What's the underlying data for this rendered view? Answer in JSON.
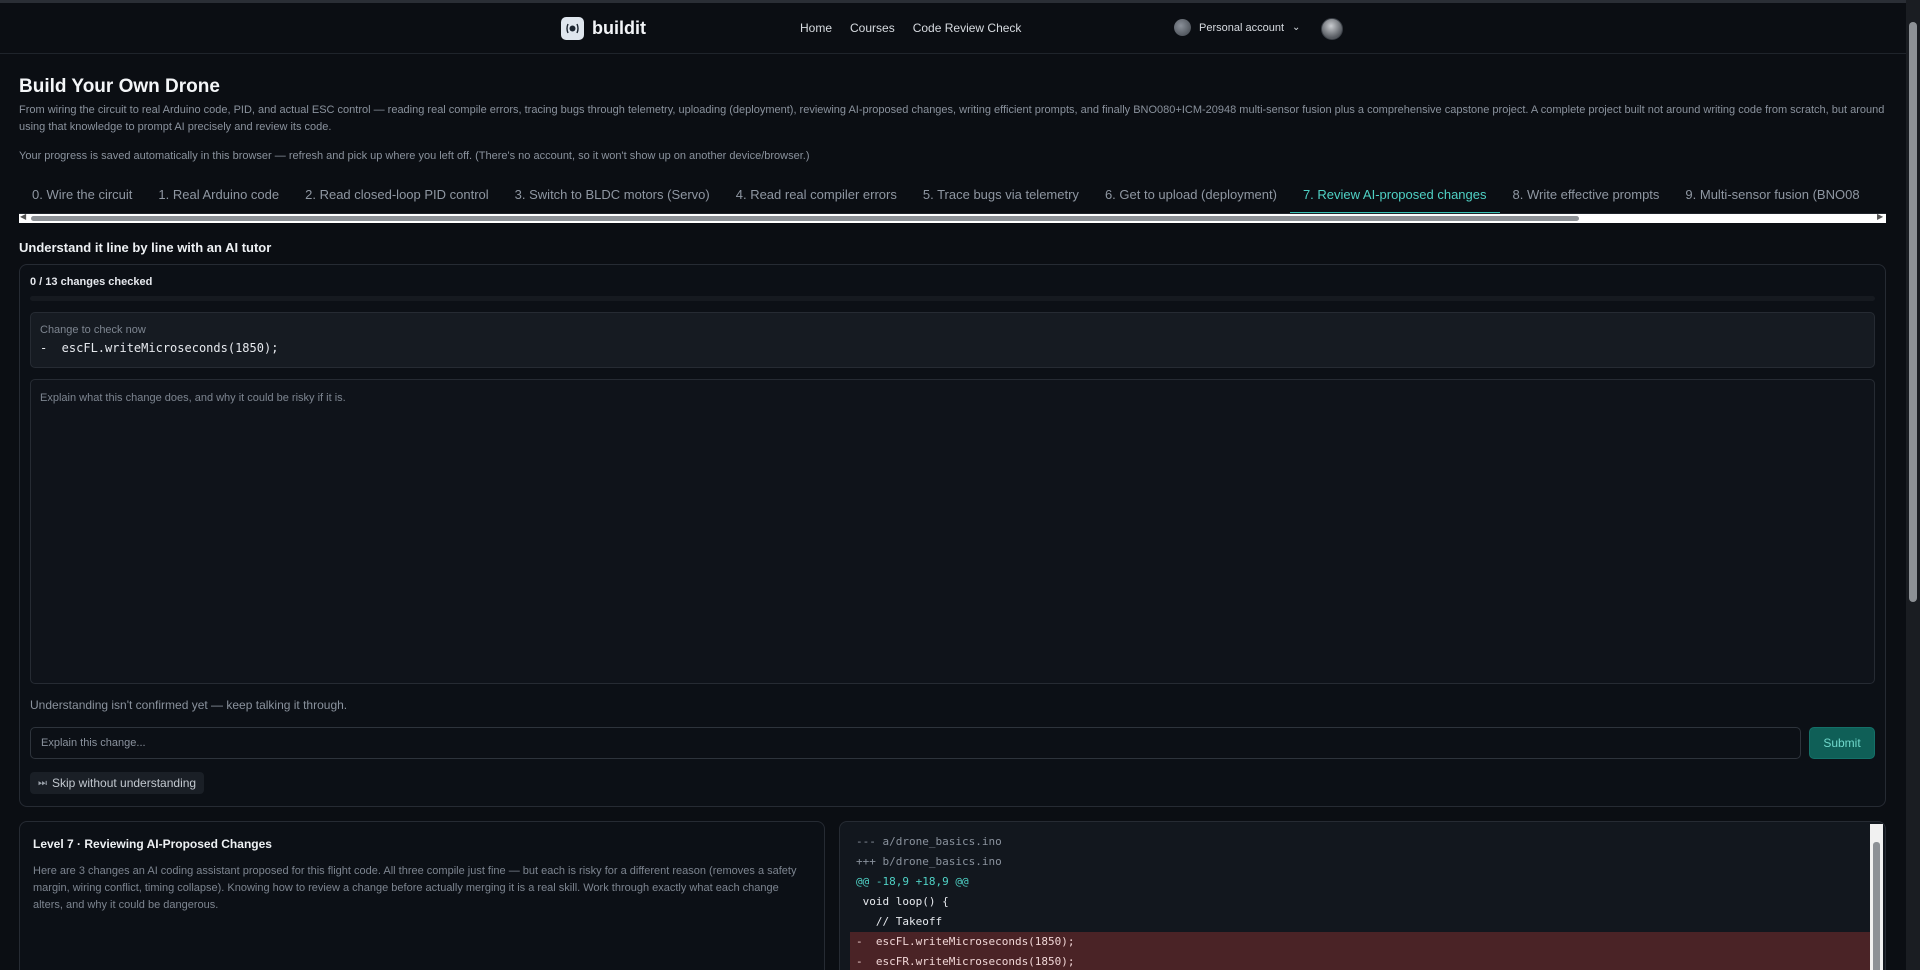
{
  "header": {
    "brand": "buildit",
    "nav": [
      "Home",
      "Courses",
      "Code Review Check"
    ],
    "account_label": "Personal account"
  },
  "intro": {
    "title": "Build Your Own Drone",
    "description": "From wiring the circuit to real Arduino code, PID, and actual ESC control — reading real compile errors, tracing bugs through telemetry, uploading (deployment), reviewing AI-proposed changes, writing efficient prompts, and finally BNO080+ICM-20948 multi-sensor fusion plus a comprehensive capstone project. A complete project built not around writing code from scratch, but around using that knowledge to prompt AI precisely and review its code.",
    "progress_note": "Your progress is saved automatically in this browser — refresh and pick up where you left off. (There's no account, so it won't show up on another device/browser.)"
  },
  "tabs": [
    "0. Wire the circuit",
    "1. Real Arduino code",
    "2. Read closed-loop PID control",
    "3. Switch to BLDC motors (Servo)",
    "4. Read real compiler errors",
    "5. Trace bugs via telemetry",
    "6. Get to upload (deployment)",
    "7. Review AI-proposed changes",
    "8. Write effective prompts",
    "9. Multi-sensor fusion (BNO08"
  ],
  "active_tab_index": 7,
  "tutor": {
    "section_title": "Understand it line by line with an AI tutor",
    "changes_count": "0 / 13 changes checked",
    "progress_fraction": 0,
    "check_label": "Change to check now",
    "check_code": "-  escFL.writeMicroseconds(1850);",
    "explain_placeholder": "Explain what this change does, and why it could be risky if it is.",
    "status": "Understanding isn't confirmed yet — keep talking it through.",
    "input_placeholder": "Explain this change...",
    "submit_label": "Submit",
    "skip_label": "Skip without understanding"
  },
  "level": {
    "title": "Level 7 · Reviewing AI-Proposed Changes",
    "description": "Here are 3 changes an AI coding assistant proposed for this flight code. All three compile just fine — but each is risky for a different reason (removes a safety margin, wiring conflict, timing collapse). Knowing how to review a change before actually merging it is a real skill. Work through exactly what each change alters, and why it could be dangerous."
  },
  "diff": {
    "lines": [
      {
        "text": "--- a/drone_basics.ino",
        "kind": "meta"
      },
      {
        "text": "+++ b/drone_basics.ino",
        "kind": "meta"
      },
      {
        "text": "@@ -18,9 +18,9 @@",
        "kind": "hunk"
      },
      {
        "text": " void loop() {",
        "kind": "ctx"
      },
      {
        "text": "   // Takeoff",
        "kind": "ctx"
      },
      {
        "text": "-  escFL.writeMicroseconds(1850);",
        "kind": "del"
      },
      {
        "text": "-  escFR.writeMicroseconds(1850);",
        "kind": "del"
      }
    ]
  },
  "colors": {
    "accent": "#4fd1c5",
    "meta": "#8a929d",
    "hunk": "#4fd1c5",
    "ctx": "#e6e9ee",
    "del_bg": "#4a2326"
  }
}
